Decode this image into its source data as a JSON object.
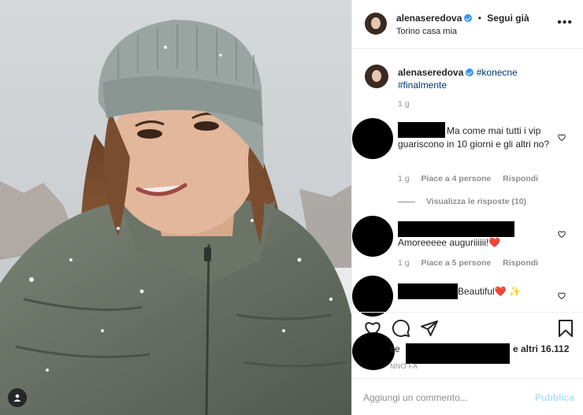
{
  "post": {
    "username": "alenaseredova",
    "follow_label": "Segui già",
    "separator": "•",
    "location": "Torino casa mia",
    "more_label": "•••",
    "caption_hashtag1": "#konecne",
    "caption_hashtag2": "#finalmente",
    "caption_time": "1 g"
  },
  "comments": [
    {
      "text": "Ma come mai tutti i vip guariscono in 10 giorni e gli altri no?",
      "time": "1 g",
      "likes": "Piace a 4 persone",
      "reply": "Rispondi",
      "view_replies": "Visualizza le risposte (10)"
    },
    {
      "text": "Amoreeeee auguriiiiii!❤️",
      "time": "1 g",
      "likes": "Piace a 5 persone",
      "reply": "Rispondi"
    },
    {
      "text": "Beautiful❤️ ✨"
    }
  ],
  "likes_bar": {
    "prefix": "ce",
    "suffix": "e altri 16.112",
    "time_ago": "NNO FA"
  },
  "composer": {
    "placeholder": "Aggiungi un commento...",
    "publish_label": "Pubblica"
  },
  "colors": {
    "verified": "#3897f0",
    "hashtag": "#00376b",
    "publish_disabled": "#b2dffc",
    "muted": "#8e8e8e"
  },
  "icons": [
    "heart-icon",
    "comment-icon",
    "share-icon",
    "bookmark-icon",
    "user-tag-icon",
    "more-icon"
  ]
}
